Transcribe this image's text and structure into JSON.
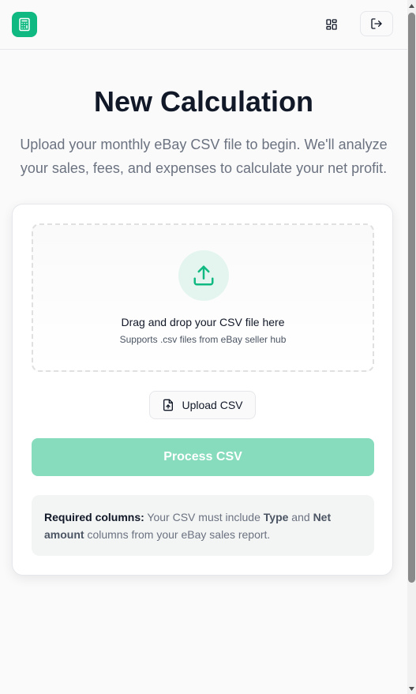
{
  "header": {
    "logo_icon": "calculator-icon",
    "dashboard_icon": "layout-grid-icon",
    "logout_icon": "log-out-icon",
    "brand_color": "#10b981"
  },
  "main": {
    "title": "New Calculation",
    "subtitle": "Upload your monthly eBay CSV file to begin. We'll analyze your sales, fees, and expenses to calculate your net profit."
  },
  "upload_card": {
    "dropzone": {
      "icon": "upload-icon",
      "title": "Drag and drop your CSV file here",
      "subtitle": "Supports .csv files from eBay seller hub"
    },
    "upload_button": {
      "icon": "file-upload-icon",
      "label": "Upload CSV"
    },
    "process_button": {
      "label": "Process CSV",
      "color": "#86dcbd"
    },
    "info": {
      "label": "Required columns:",
      "text_1": " Your CSV must include ",
      "col_1": "Type",
      "text_2": " and ",
      "col_2": "Net amount",
      "text_3": " columns from your eBay sales report."
    }
  }
}
